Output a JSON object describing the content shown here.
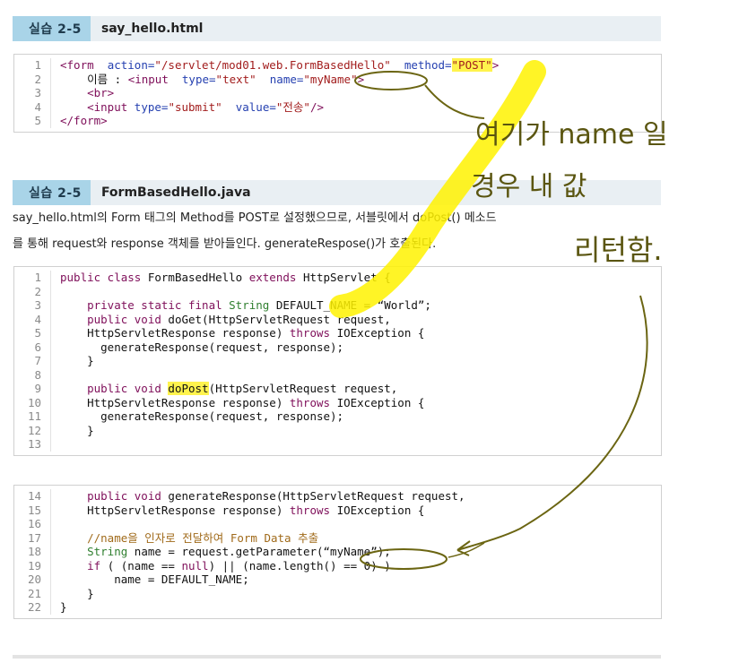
{
  "section1": {
    "tag": "실습 2-5",
    "file": "say_hello.html"
  },
  "html_code": [
    {
      "n": "1",
      "parts": [
        [
          "t",
          "<form  "
        ],
        [
          "a",
          "action="
        ],
        [
          "s",
          "\"/servlet/mod01.web.FormBasedHello\""
        ],
        [
          "p",
          "  "
        ],
        [
          "a",
          "method="
        ],
        [
          "sh",
          "\"POST\""
        ],
        [
          "t",
          ">"
        ]
      ]
    },
    {
      "n": "2",
      "parts": [
        [
          "p",
          "    이름 : "
        ],
        [
          "t",
          "<input  "
        ],
        [
          "a",
          "type="
        ],
        [
          "s",
          "\"text\""
        ],
        [
          "p",
          "  "
        ],
        [
          "a",
          "name="
        ],
        [
          "s",
          "\"myName\""
        ],
        [
          "t",
          ">"
        ]
      ]
    },
    {
      "n": "3",
      "parts": [
        [
          "p",
          "    "
        ],
        [
          "t",
          "<br>"
        ]
      ]
    },
    {
      "n": "4",
      "parts": [
        [
          "p",
          "    "
        ],
        [
          "t",
          "<input "
        ],
        [
          "a",
          "type="
        ],
        [
          "s",
          "\"submit\""
        ],
        [
          "p",
          "  "
        ],
        [
          "a",
          "value="
        ],
        [
          "s",
          "\"전송\""
        ],
        [
          "t",
          "/>"
        ]
      ]
    },
    {
      "n": "5",
      "parts": [
        [
          "t",
          "</form>"
        ]
      ]
    }
  ],
  "section2": {
    "tag": "실습 2-5",
    "file": "FormBasedHello.java"
  },
  "description": {
    "line1": "say_hello.html의 Form 태그의 Method를 POST로 설정했으므로, 서블릿에서 doPost() 메소드",
    "line2": "를 통해 request와 response 객체를 받아들인다. generateRespose()가 호출된다."
  },
  "java_code_a": [
    {
      "n": "1",
      "parts": [
        [
          "k",
          "public class "
        ],
        [
          "p",
          "FormBasedHello "
        ],
        [
          "k",
          "extends "
        ],
        [
          "p",
          "HttpServlet {"
        ]
      ]
    },
    {
      "n": "2",
      "parts": []
    },
    {
      "n": "3",
      "parts": [
        [
          "k",
          "    private static final "
        ],
        [
          "y",
          "String "
        ],
        [
          "p",
          "DEFAULT_NAME = “World”;"
        ]
      ]
    },
    {
      "n": "4",
      "parts": [
        [
          "k",
          "    public void "
        ],
        [
          "p",
          "doGet(HttpServletRequest request,"
        ]
      ]
    },
    {
      "n": "5",
      "parts": [
        [
          "p",
          "    HttpServletResponse response) "
        ],
        [
          "k",
          "throws "
        ],
        [
          "p",
          "IOException {"
        ]
      ]
    },
    {
      "n": "6",
      "parts": [
        [
          "p",
          "      generateResponse(request, response);"
        ]
      ]
    },
    {
      "n": "7",
      "parts": [
        [
          "p",
          "    }"
        ]
      ]
    },
    {
      "n": "8",
      "parts": []
    },
    {
      "n": "9",
      "parts": [
        [
          "k",
          "    public void "
        ],
        [
          "ph",
          "doPost"
        ],
        [
          "p",
          "(HttpServletRequest request,"
        ]
      ]
    },
    {
      "n": "10",
      "parts": [
        [
          "p",
          "    HttpServletResponse response) "
        ],
        [
          "k",
          "throws "
        ],
        [
          "p",
          "IOException {"
        ]
      ]
    },
    {
      "n": "11",
      "parts": [
        [
          "p",
          "      generateResponse(request, response);"
        ]
      ]
    },
    {
      "n": "12",
      "parts": [
        [
          "p",
          "    }"
        ]
      ]
    },
    {
      "n": "13",
      "parts": []
    }
  ],
  "java_code_b": [
    {
      "n": "14",
      "parts": [
        [
          "k",
          "    public void "
        ],
        [
          "p",
          "generateResponse(HttpServletRequest request,"
        ]
      ]
    },
    {
      "n": "15",
      "parts": [
        [
          "p",
          "    HttpServletResponse response) "
        ],
        [
          "k",
          "throws "
        ],
        [
          "p",
          "IOException {"
        ]
      ]
    },
    {
      "n": "16",
      "parts": []
    },
    {
      "n": "17",
      "parts": [
        [
          "c",
          "    //name을 인자로 전달하여 Form Data 추출"
        ]
      ]
    },
    {
      "n": "18",
      "parts": [
        [
          "y",
          "    String "
        ],
        [
          "p",
          "name = request.getParameter(“myName”);"
        ]
      ]
    },
    {
      "n": "19",
      "parts": [
        [
          "k",
          "    if "
        ],
        [
          "p",
          "( (name == "
        ],
        [
          "k",
          "null"
        ],
        [
          "p",
          ") || (name.length() == 0) )"
        ]
      ]
    },
    {
      "n": "20",
      "parts": [
        [
          "p",
          "        name = DEFAULT_NAME;"
        ]
      ]
    },
    {
      "n": "21",
      "parts": [
        [
          "p",
          "    }"
        ]
      ]
    },
    {
      "n": "22",
      "parts": [
        [
          "p",
          "}"
        ]
      ]
    }
  ],
  "annotations": {
    "line1": "여기가 name 일",
    "line2": "경우 내 값",
    "line3": "리턴함."
  },
  "colors": {
    "highlight": "#fff34d",
    "ink": "#5a5510",
    "section_tag": "#a9d4e8"
  }
}
